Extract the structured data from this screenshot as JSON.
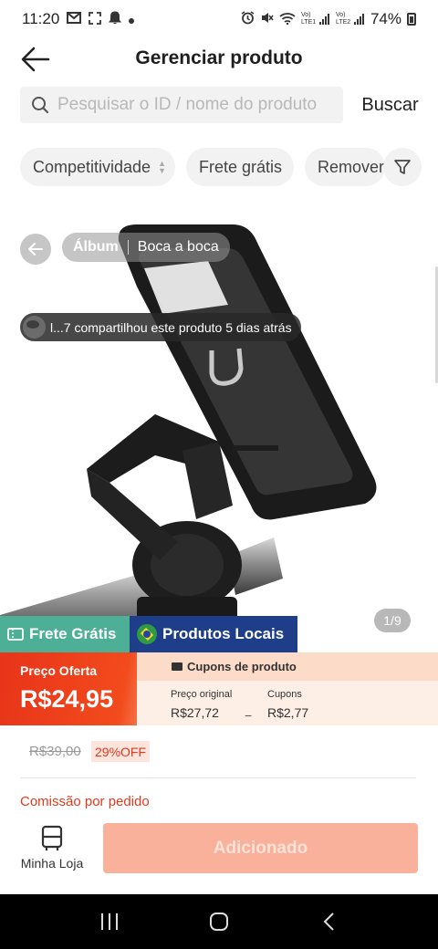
{
  "status_bar": {
    "time": "11:20",
    "left_icons": [
      "mail-icon",
      "screenshot-icon",
      "bell-icon",
      "dot-icon"
    ],
    "right_icons": [
      "alarm-icon",
      "mute-icon",
      "wifi-icon",
      "signal-lte1-icon",
      "signal-lte2-icon"
    ],
    "lte1": "Vo) LTE1",
    "lte2": "Vo) LTE2",
    "battery": "74%"
  },
  "header": {
    "title": "Gerenciar produto",
    "back_icon": "arrow-left-icon"
  },
  "search": {
    "placeholder": "Pesquisar o ID / nome do produto",
    "value": "",
    "button_label": "Buscar"
  },
  "filters": {
    "chips": [
      "Competitividade",
      "Frete grátis",
      "Remover"
    ],
    "filter_icon": "funnel-icon"
  },
  "gallery": {
    "tabs": [
      "Álbum",
      "Boca a boca"
    ],
    "active_tab": "Álbum",
    "share_text": "l...7 compartilhou este produto 5 dias atrás",
    "counter": "1/9"
  },
  "badges": {
    "free_shipping": "Frete Grátis",
    "local_products": "Produtos Locais"
  },
  "price": {
    "offer_label": "Preço Oferta",
    "offer_value": "R$24,95",
    "coupons_title": "Cupons de produto",
    "original_label": "Preço original",
    "original_value": "R$27,72",
    "coupons_label": "Cupons",
    "coupons_value": "R$2,77",
    "old_price": "R$39,00",
    "discount": "29%OFF",
    "commission": "Comissão por pedido"
  },
  "actions": {
    "store_label": "Minha Loja",
    "add_label": "Adicionado"
  },
  "colors": {
    "accent": "#e4391b",
    "free_shipping_bg": "#4caf96",
    "local_bg": "#1f3e89",
    "add_button_bg": "#f9b19b"
  }
}
